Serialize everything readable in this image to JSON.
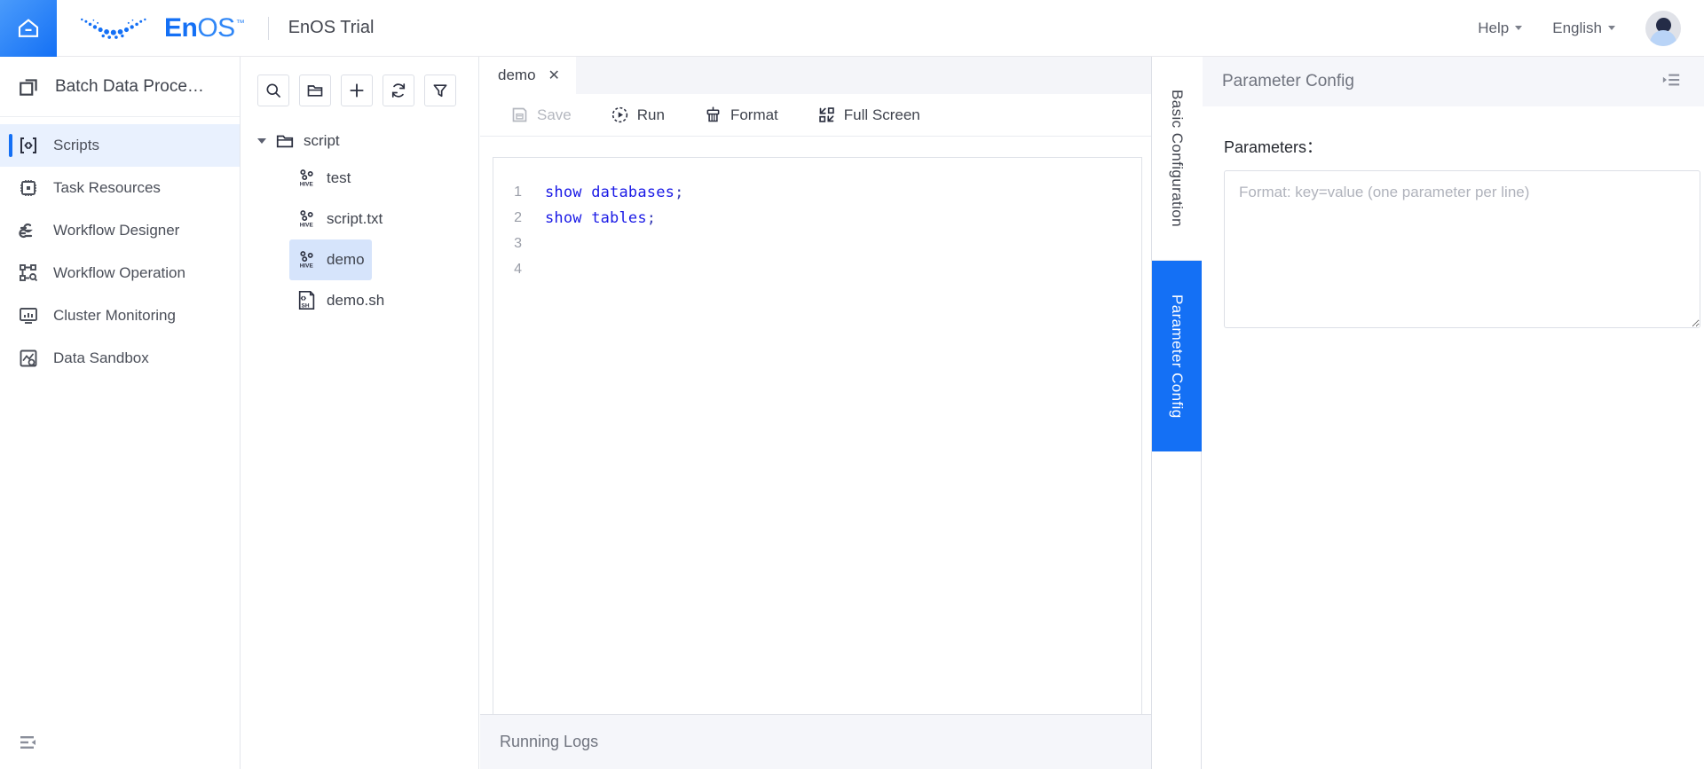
{
  "header": {
    "home_icon": "home-icon",
    "brand_en": "En",
    "brand_os": "OS",
    "brand_tm": "™",
    "app_title": "EnOS Trial",
    "menus": [
      {
        "label": "Help",
        "icon": "chevron-down-icon"
      },
      {
        "label": "English",
        "icon": "chevron-down-icon"
      }
    ],
    "avatar_icon": "avatar-icon"
  },
  "sidebar": {
    "product": {
      "label": "Batch Data Proce…",
      "icon": "stack-icon"
    },
    "items": [
      {
        "label": "Scripts",
        "icon": "code-brackets-icon",
        "active": true
      },
      {
        "label": "Task Resources",
        "icon": "cpu-icon",
        "active": false
      },
      {
        "label": "Workflow Designer",
        "icon": "flow-link-icon",
        "active": false
      },
      {
        "label": "Workflow Operation",
        "icon": "flow-search-icon",
        "active": false
      },
      {
        "label": "Cluster Monitoring",
        "icon": "monitor-chart-icon",
        "active": false
      },
      {
        "label": "Data Sandbox",
        "icon": "sandbox-chart-icon",
        "active": false
      }
    ],
    "fold_icon": "menu-fold-icon"
  },
  "tree": {
    "toolbar": [
      {
        "name": "search-icon",
        "title": "Search"
      },
      {
        "name": "new-folder-icon",
        "title": "New Folder"
      },
      {
        "name": "plus-icon",
        "title": "New"
      },
      {
        "name": "refresh-icon",
        "title": "Refresh"
      },
      {
        "name": "filter-icon",
        "title": "Filter"
      }
    ],
    "root": {
      "label": "script",
      "icon": "folder-icon",
      "expanded": true
    },
    "files": [
      {
        "label": "test",
        "icon": "hive-file-icon",
        "selected": false
      },
      {
        "label": "script.txt",
        "icon": "hive-file-icon",
        "selected": false
      },
      {
        "label": "demo",
        "icon": "hive-file-icon",
        "selected": true
      },
      {
        "label": "demo.sh",
        "icon": "shell-file-icon",
        "selected": false
      }
    ]
  },
  "editor": {
    "tabs": [
      {
        "label": "demo",
        "close_icon": "close-icon",
        "active": true
      }
    ],
    "toolbar": [
      {
        "label": "Save",
        "icon": "save-icon",
        "disabled": true
      },
      {
        "label": "Run",
        "icon": "run-icon",
        "disabled": false
      },
      {
        "label": "Format",
        "icon": "format-brush-icon",
        "disabled": false
      },
      {
        "label": "Full Screen",
        "icon": "fullscreen-icon",
        "disabled": false
      }
    ],
    "lines": [
      {
        "no": "1",
        "kw1": "show",
        "kw2": "databases",
        "punc": ";"
      },
      {
        "no": "2",
        "kw1": "show",
        "kw2": "tables",
        "punc": ";"
      },
      {
        "no": "3",
        "kw1": "",
        "kw2": "",
        "punc": ""
      },
      {
        "no": "4",
        "kw1": "",
        "kw2": "",
        "punc": ""
      }
    ],
    "logs_label": "Running Logs"
  },
  "vtabs": [
    {
      "label": "Basic Configuration",
      "active": false
    },
    {
      "label": "Parameter Config",
      "active": true
    }
  ],
  "right_panel": {
    "title": "Parameter Config",
    "fold_icon": "menu-unfold-icon",
    "field_label": "Parameters：",
    "textarea_value": "",
    "textarea_placeholder": "Format: key=value (one parameter per line)"
  },
  "colors": {
    "brand_blue": "#1470f5",
    "active_tab_blue": "#1470f5",
    "selection_blue": "#d6e4fb",
    "sidebar_active_bg": "#e9f1fe",
    "keyword_blue": "#1a1ae6",
    "panel_grey": "#f5f6fa"
  }
}
